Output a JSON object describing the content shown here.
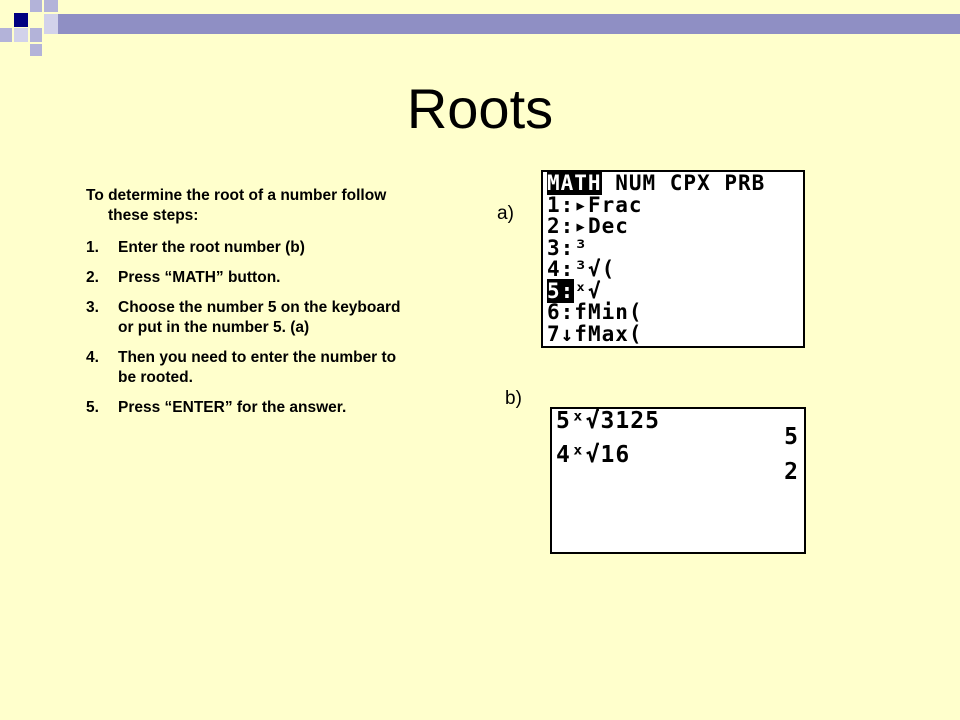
{
  "slide": {
    "title": "Roots",
    "intro": "To determine the root of a number follow these steps:",
    "steps": [
      {
        "num": "1.",
        "text": "Enter the root number (b)"
      },
      {
        "num": "2.",
        "text": "Press “MATH” button."
      },
      {
        "num": "3.",
        "text": "Choose the number 5 on the keyboard or put in the number 5. (a)"
      },
      {
        "num": "4.",
        "text": "Then you need to enter the number to be rooted."
      },
      {
        "num": "5.",
        "text": "Press “ENTER” for the answer."
      }
    ],
    "label_a": "a)",
    "label_b": "b)"
  },
  "screen_a": {
    "menu_active": "MATH",
    "menu_rest": " NUM CPX PRB",
    "items": [
      {
        "key": "1:",
        "text": "▸Frac"
      },
      {
        "key": "2:",
        "text": "▸Dec"
      },
      {
        "key": "3:",
        "text": "³"
      },
      {
        "key": "4:",
        "text": "³√("
      },
      {
        "key": "5:",
        "text": "ˣ√"
      },
      {
        "key": "6:",
        "text": "fMin("
      },
      {
        "key": "7↓",
        "text": "fMax("
      }
    ]
  },
  "screen_b": {
    "lines": [
      {
        "expr": "5ˣ√3125",
        "result": "5"
      },
      {
        "expr": "4ˣ√16",
        "result": "2"
      }
    ]
  },
  "colors": {
    "background": "#ffffcc",
    "accent_bar": "#8f8fc4",
    "square_dark": "#000080",
    "square_light": "#b3b3d9"
  }
}
